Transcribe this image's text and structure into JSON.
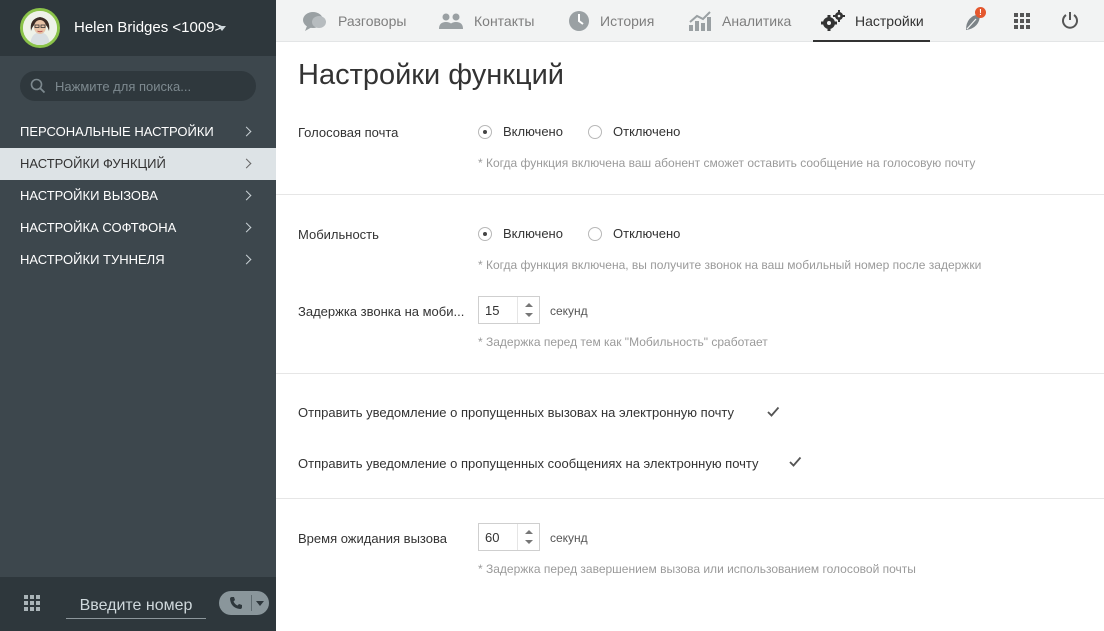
{
  "user": {
    "name": "Helen Bridges <1009>"
  },
  "search": {
    "placeholder": "Нажмите для поиска..."
  },
  "sidebar": {
    "items": [
      {
        "label": "ПЕРСОНАЛЬНЫЕ НАСТРОЙКИ"
      },
      {
        "label": "НАСТРОЙКИ ФУНКЦИЙ"
      },
      {
        "label": "НАСТРОЙКИ ВЫЗОВА"
      },
      {
        "label": "НАСТРОЙКА СОФТФОНА"
      },
      {
        "label": "НАСТРОЙКИ ТУННЕЛЯ"
      }
    ],
    "active_index": 1
  },
  "dialer": {
    "placeholder": "Введите номер"
  },
  "topnav": {
    "tabs": [
      {
        "label": "Разговоры",
        "icon": "chat-icon"
      },
      {
        "label": "Контакты",
        "icon": "contacts-icon"
      },
      {
        "label": "История",
        "icon": "clock-icon"
      },
      {
        "label": "Аналитика",
        "icon": "analytics-icon"
      },
      {
        "label": "Настройки",
        "icon": "gears-icon"
      }
    ],
    "active_index": 4,
    "notification_badge": "!"
  },
  "page": {
    "title": "Настройки функций"
  },
  "voicemail": {
    "label": "Голосовая почта",
    "on_label": "Включено",
    "off_label": "Отключено",
    "selected": "on",
    "hint": "* Когда функция включена ваш абонент сможет оставить сообщение на голосовую почту"
  },
  "mobility": {
    "label": "Мобильность",
    "on_label": "Включено",
    "off_label": "Отключено",
    "selected": "on",
    "hint": "* Когда функция включена, вы получите звонок на ваш мобильный номер после задержки",
    "delay_label": "Задержка звонка на моби...",
    "delay_value": "15",
    "delay_unit": "секунд",
    "delay_hint": "* Задержка перед тем как \"Мобильность\" сработает"
  },
  "notifications": {
    "missed_calls_label": "Отправить уведомление о пропущенных вызовах на электронную почту",
    "missed_calls_checked": true,
    "missed_messages_label": "Отправить уведомление о пропущенных сообщениях на электронную почту",
    "missed_messages_checked": true
  },
  "timeout": {
    "label": "Время ожидания вызова",
    "value": "60",
    "unit": "секунд",
    "hint": "* Задержка перед завершением вызова или использованием голосовой почты"
  },
  "colors": {
    "sidebar_bg": "#3d474d",
    "sidebar_dark": "#2e373c",
    "active_item_bg": "#dde3e6",
    "avatar_ring": "#8bc34a",
    "badge": "#e4572e"
  }
}
